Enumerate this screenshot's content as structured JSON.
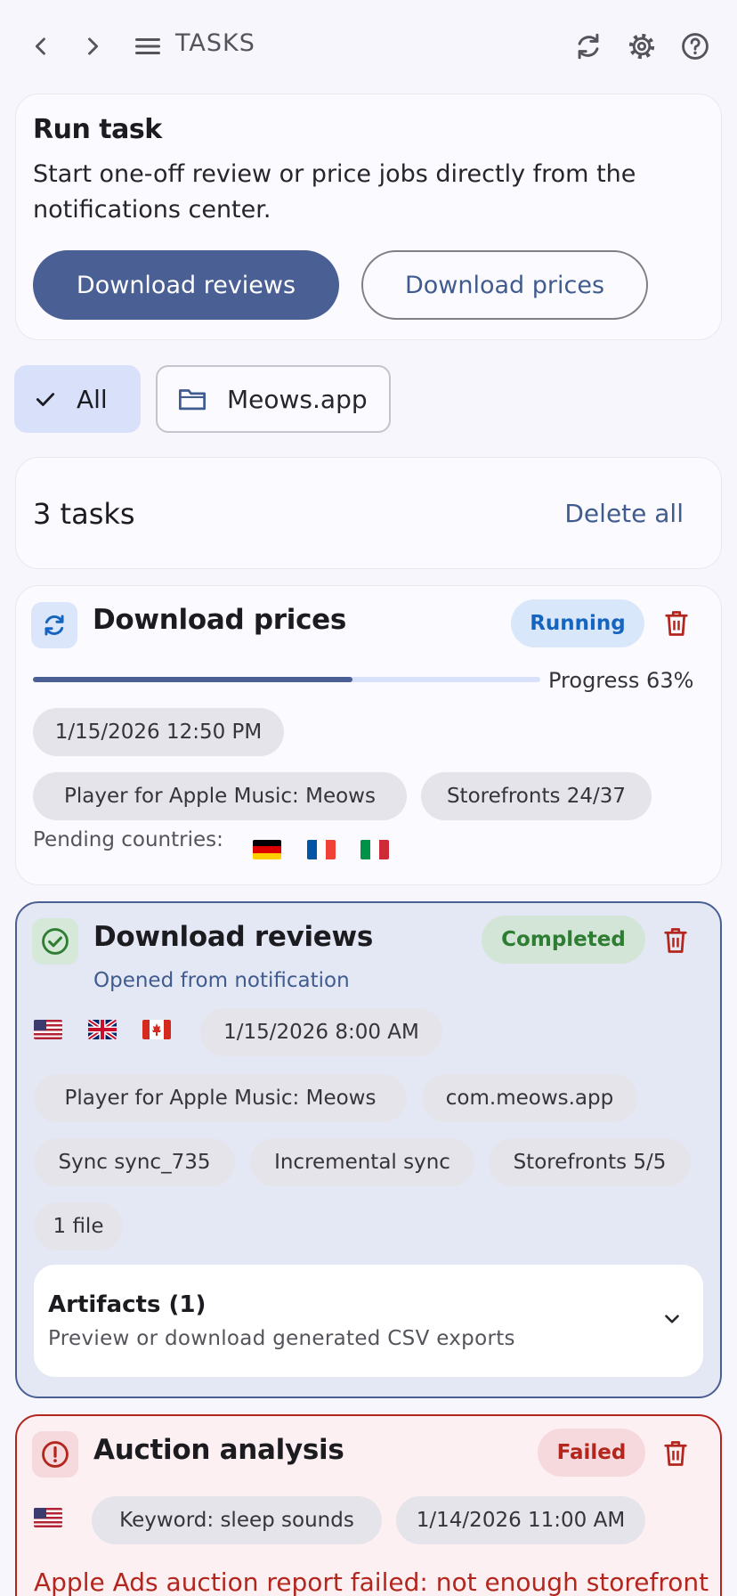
{
  "topbar": {
    "title": "TASKS",
    "icons": [
      "chevron-left-icon",
      "chevron-right-icon",
      "menu-icon",
      "refresh-icon",
      "gear-icon",
      "help-icon"
    ]
  },
  "run_task": {
    "title": "Run task",
    "description": "Start one-off review or price jobs directly from the notifications center.",
    "primary_button": "Download reviews",
    "secondary_button": "Download prices"
  },
  "filters": {
    "all_label": "All",
    "app_label": "Meows.app"
  },
  "summary": {
    "count_label": "3 tasks",
    "delete_all_label": "Delete all"
  },
  "tasks": [
    {
      "title": "Download prices",
      "status": "Running",
      "status_color": "#1565c0",
      "progress_label": "Progress 63%",
      "progress": 0.63,
      "date": "1/15/2026 12:50 PM",
      "app": "Player for Apple Music: Meows",
      "storefronts": "Storefronts 24/37",
      "pending_label": "Pending countries:",
      "pending_flags": [
        "DE",
        "FR",
        "IT"
      ]
    },
    {
      "title": "Download reviews",
      "subtitle": "Opened from notification",
      "status": "Completed",
      "status_color": "#2e7d32",
      "flags": [
        "US",
        "GB",
        "CA"
      ],
      "date": "1/15/2026 8:00 AM",
      "app": "Player for Apple Music: Meows",
      "bundle": "com.meows.app",
      "sync": "Sync sync_735",
      "sync_type": "Incremental sync",
      "storefronts": "Storefronts 5/5",
      "files": "1 file",
      "artifacts_title": "Artifacts (1)",
      "artifacts_subtitle": "Preview or download generated CSV exports"
    },
    {
      "title": "Auction analysis",
      "status": "Failed",
      "status_color": "#b3261e",
      "flags": [
        "US"
      ],
      "keyword": "Keyword: sleep sounds",
      "date": "1/14/2026 11:00 AM",
      "error": "Apple Ads auction report failed: not enough storefront"
    }
  ]
}
